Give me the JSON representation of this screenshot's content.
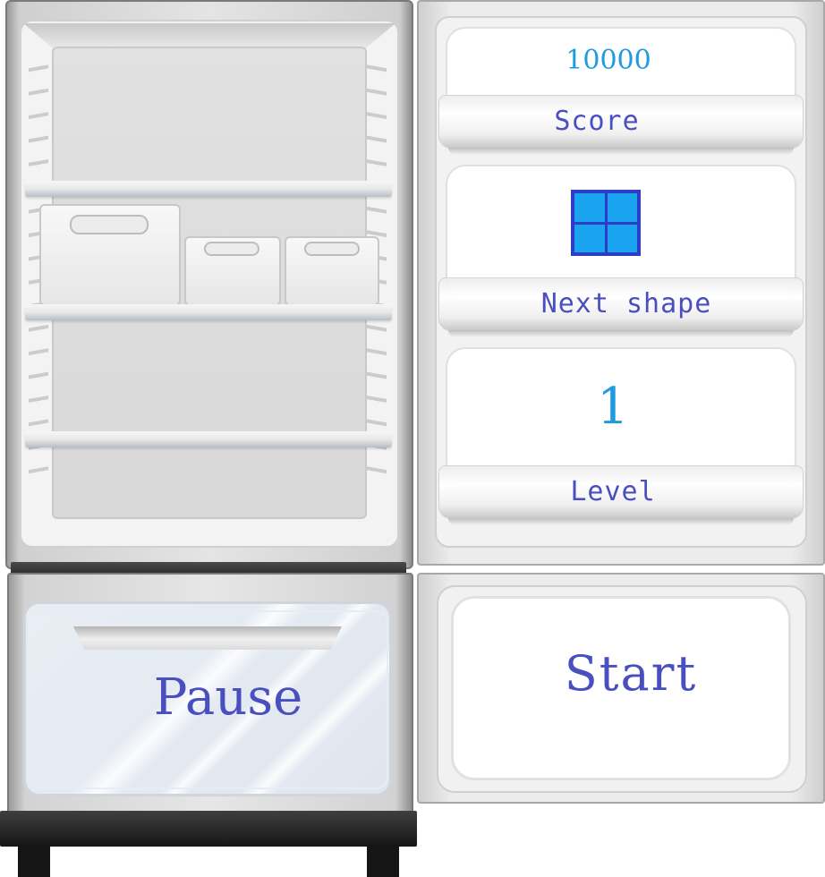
{
  "hud": {
    "score_value": "10000",
    "score_label": "Score",
    "next_shape_label": "Next shape",
    "level_value": "1",
    "level_label": "Level"
  },
  "next_shape": {
    "name": "O-piece",
    "cells": [
      [
        1,
        1
      ],
      [
        1,
        1
      ]
    ],
    "fill_color": "#1aa3ee",
    "border_color": "#2e3dc8"
  },
  "controls": {
    "pause_label": "Pause",
    "start_label": "Start"
  },
  "theme": {
    "label_color": "#4a4fc0",
    "value_color": "#1f9be0"
  }
}
